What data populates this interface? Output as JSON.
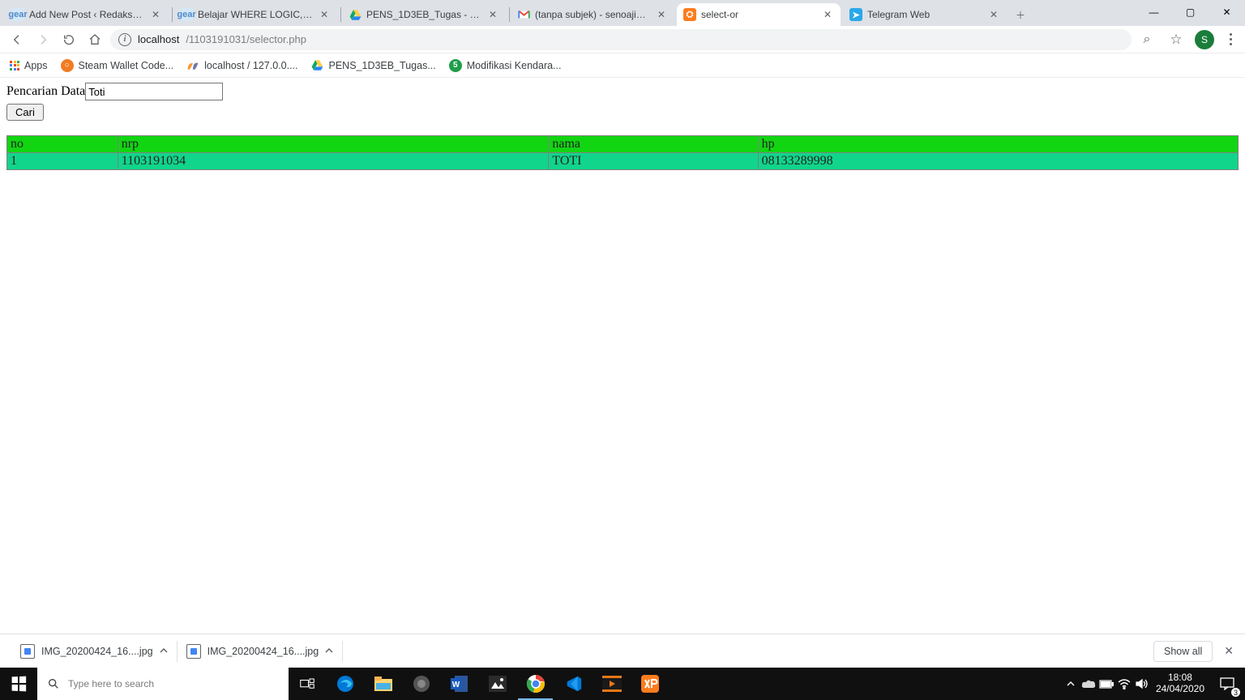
{
  "window": {
    "min": "—",
    "max": "▢",
    "close": "✕"
  },
  "tabs": [
    {
      "title": "Add New Post ‹ Redaksiana –",
      "fav": "gear",
      "favbg": "#d5e8f7",
      "favfg": "#4f8bca",
      "active": false
    },
    {
      "title": "Belajar WHERE LOGIC,dan DE",
      "fav": "gear",
      "favbg": "#d5e8f7",
      "favfg": "#4f8bca",
      "active": false
    },
    {
      "title": "PENS_1D3EB_Tugas - Google",
      "fav": "drive",
      "favbg": "transparent",
      "favfg": "",
      "active": false
    },
    {
      "title": "(tanpa subjek) - senoaji3599",
      "fav": "M",
      "favbg": "transparent",
      "favfg": "",
      "active": false,
      "gmail": true
    },
    {
      "title": "select-or",
      "fav": "⛭",
      "favbg": "#fb7c1e",
      "favfg": "#fff",
      "active": true
    },
    {
      "title": "Telegram Web",
      "fav": "➤",
      "favbg": "#29a9ea",
      "favfg": "#fff",
      "active": false
    }
  ],
  "newtab": "＋",
  "address": {
    "info": "i",
    "host": "localhost",
    "path": "/1103191031/selector.php"
  },
  "addr_icons": {
    "zoom": "⌕",
    "star": "☆",
    "avatar": "S"
  },
  "bookmarks": {
    "apps_label": "Apps",
    "items": [
      {
        "icon": "○",
        "label": "Steam Wallet Code...",
        "bg": "#f27b22",
        "fg": "#fff"
      },
      {
        "icon": "pma",
        "label": "localhost / 127.0.0....",
        "bg": "",
        "fg": "#c97f1c",
        "pma": true
      },
      {
        "icon": "drive",
        "label": "PENS_1D3EB_Tugas...",
        "bg": "",
        "fg": ""
      },
      {
        "icon": "5",
        "label": "Modifikasi Kendara...",
        "bg": "#1e9e4a",
        "fg": "#fff"
      }
    ]
  },
  "page": {
    "search_label": "Pencarian Data",
    "search_value": "Toti",
    "search_button": "Cari",
    "headers": [
      "no",
      "nrp",
      "nama",
      "hp"
    ],
    "rows": [
      [
        "1",
        "1103191034",
        "TOTI",
        "08133289998"
      ]
    ]
  },
  "downloads": {
    "items": [
      {
        "name": "IMG_20200424_16....jpg"
      },
      {
        "name": "IMG_20200424_16....jpg"
      }
    ],
    "showall": "Show all",
    "close": "✕"
  },
  "taskbar": {
    "search_placeholder": "Type here to search",
    "time": "18:08",
    "date": "24/04/2020",
    "badge": "3"
  }
}
